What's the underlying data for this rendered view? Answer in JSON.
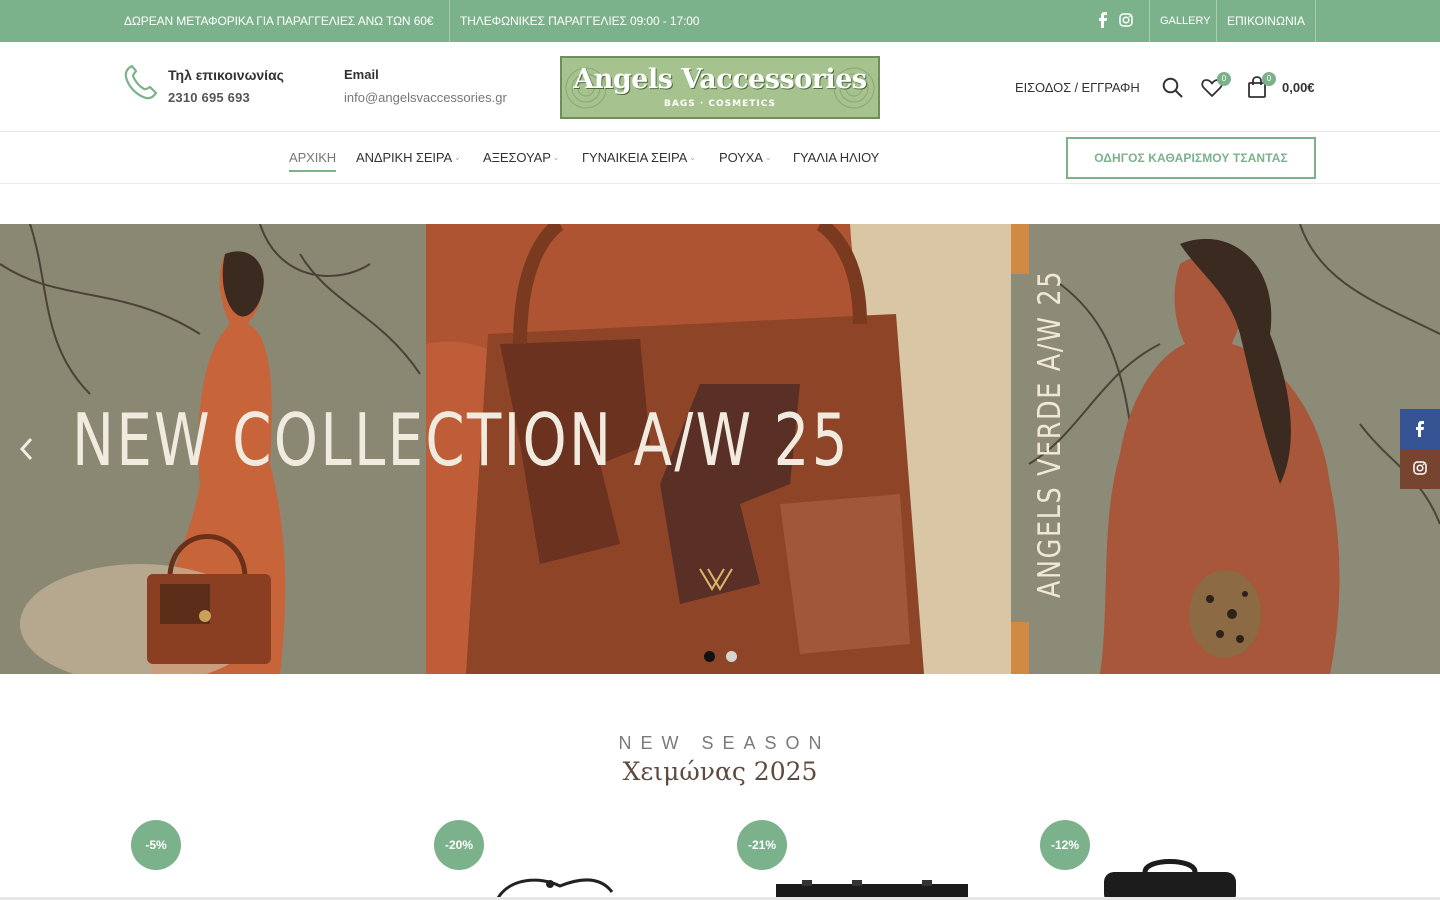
{
  "topbar": {
    "shipping_text": "ΔΩΡΕΑΝ ΜΕΤΑΦΟΡΙΚΑ ΓΙΑ ΠΑΡΑΓΓΕΛΙΕΣ ΑΝΩ ΤΩΝ 60€",
    "phone_orders_text": "ΤΗΛΕΦΩΝΙΚΕΣ ΠΑΡΑΓΓΕΛΙΕΣ 09:00 - 17:00",
    "links": {
      "gallery": "GALLERY",
      "contact": "ΕΠΙΚΟΙΝΩΝΙΑ"
    },
    "social_icons": [
      "facebook-icon",
      "instagram-icon"
    ]
  },
  "header": {
    "phone": {
      "label": "Τηλ επικοινωνίας",
      "number": "2310 695 693"
    },
    "email": {
      "label": "Email",
      "value": "info@angelsvaccessories.gr"
    },
    "logo": {
      "text": "Angels Vaccessories",
      "subtext": "BAGS · COSMETICS"
    },
    "login_label": "ΕΙΣΟΔΟΣ / ΕΓΓΡΑΦΗ",
    "wishlist_count": "0",
    "cart_count": "0",
    "cart_total": "0,00€"
  },
  "nav": {
    "items": [
      {
        "label": "ΑΡΧΙΚΗ",
        "active": true
      },
      {
        "label": "ΑΝΔΡΙΚΗ ΣΕΙΡΑ",
        "has_dropdown": true
      },
      {
        "label": "ΑΞΕΣΟΥΑΡ",
        "has_dropdown": true
      },
      {
        "label": "ΓΥΝΑΙΚΕΙΑ ΣΕΙΡΑ",
        "has_dropdown": true
      },
      {
        "label": "ΡΟΥΧΑ",
        "has_dropdown": true
      },
      {
        "label": "ΓΥΑΛΙΑ ΗΛΙΟΥ",
        "has_dropdown": false
      }
    ],
    "guide_button": "ΟΔΗΓΟΣ ΚΑΘΑΡΙΣΜΟΥ ΤΣΑΝΤΑΣ"
  },
  "hero": {
    "headline": "NEW COLLECTION A/W 25",
    "vertical_text": "ANGELS VERDE A/W 25",
    "slide_count": 2,
    "active_slide": 1
  },
  "new_season": {
    "title": "NEW SEASON",
    "subtitle": "Χειμώνας 2025"
  },
  "products": [
    {
      "discount": "-5%"
    },
    {
      "discount": "-20%"
    },
    {
      "discount": "-21%"
    },
    {
      "discount": "-12%"
    }
  ],
  "colors": {
    "accent": "#7cb28b",
    "facebook": "#365493",
    "instagram": "#774430"
  }
}
